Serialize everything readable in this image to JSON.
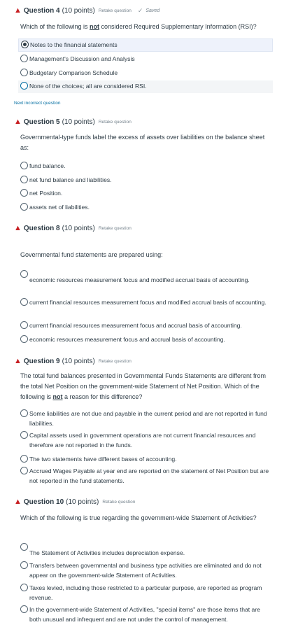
{
  "q4": {
    "title": "Question 4",
    "points": "(10 points)",
    "retake": "Retake question",
    "saved": "Saved",
    "prompt_pre": "Which of the following is ",
    "prompt_em": "not",
    "prompt_post": " considered Required Supplementary Information (RSI)?",
    "answers": [
      "Notes to the financial statements",
      "Management's Discussion and Analysis",
      "Budgetary Comparison Schedule",
      "None of the choices; all are considered RSI."
    ]
  },
  "next_incorrect": "Next incorrect question",
  "q5": {
    "title": "Question 5",
    "points": "(10 points)",
    "retake": "Retake question",
    "prompt": "Governmental-type funds label the excess of assets over liabilities on the balance sheet as:",
    "answers": [
      "fund balance.",
      "net fund balance and liabilities.",
      "net Position.",
      "assets net of liabilities."
    ]
  },
  "q8": {
    "title": "Question 8",
    "points": "(10 points)",
    "retake": "Retake question",
    "prompt": "Governmental fund statements are prepared using:",
    "answers": [
      "economic resources measurement focus and modified accrual basis of accounting.",
      "current financial resources measurement focus and modified accrual basis of accounting.",
      "current financial resources measurement focus and accrual basis of accounting.",
      "economic resources measurement focus and accrual basis of accounting."
    ]
  },
  "q9": {
    "title": "Question 9",
    "points": "(10 points)",
    "retake": "Retake question",
    "prompt_pre": "The total fund balances presented in Governmental Funds Statements are different from the total Net Position on the government-wide Statement of Net Position. Which of the following is ",
    "prompt_em": "not",
    "prompt_post": " a reason for this difference?",
    "answers": [
      "Some liabilities are not due and payable in the current period and are not reported in fund liabilities.",
      "Capital assets used in government operations are not current financial resources and therefore are not reported in the funds.",
      "The two statements have different bases of accounting.",
      "Accrued Wages Payable at year end are reported on the statement of Net Position but are not reported in the fund statements."
    ]
  },
  "q10": {
    "title": "Question 10",
    "points": "(10 points)",
    "retake": "Retake question",
    "prompt": "Which of the following is true regarding the government-wide Statement of Activities?",
    "answers": [
      "The Statement of Activities includes depreciation expense.",
      "Transfers between governmental and business type activities are eliminated and do not appear on the government-wide Statement of Activities.",
      "Taxes levied, including those restricted to a particular purpose, are reported as program revenue.",
      "In the government-wide Statement of Activities, \"special items\" are those items that are both unusual and infrequent and are not under the control of management."
    ]
  }
}
